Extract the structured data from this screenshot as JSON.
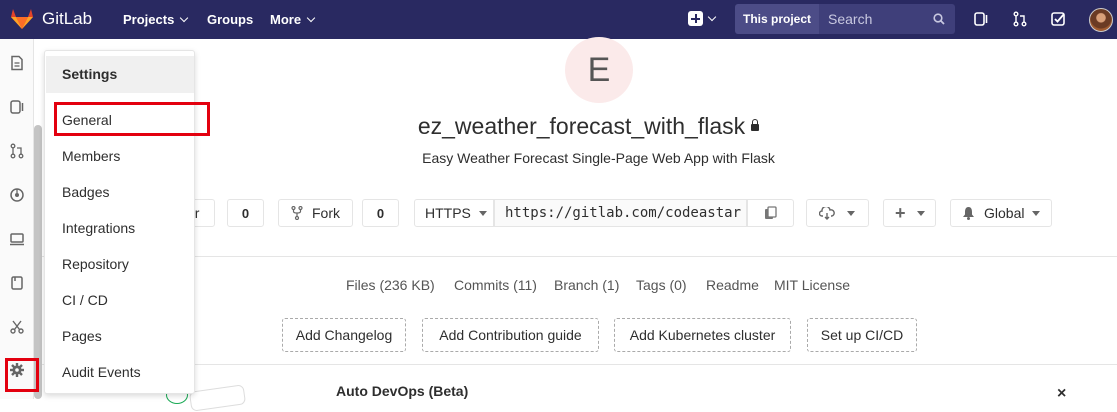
{
  "topbar": {
    "app_name": "GitLab",
    "nav": {
      "projects": "Projects",
      "groups": "Groups",
      "more": "More"
    },
    "scope_label": "This project",
    "search_placeholder": "Search",
    "icons": [
      "gitlab-logo",
      "plus-icon",
      "issues-icon",
      "merge-request-icon",
      "todo-check-icon",
      "search-icon",
      "user-avatar"
    ]
  },
  "sidebar": {
    "icons": [
      "project-icon",
      "issues-icon",
      "merge-request-icon",
      "ci-cd-icon",
      "operations-icon",
      "wiki-icon",
      "snippets-icon",
      "settings-gear-icon"
    ]
  },
  "settings_menu": {
    "header": "Settings",
    "items": [
      "General",
      "Members",
      "Badges",
      "Integrations",
      "Repository",
      "CI / CD",
      "Pages",
      "Audit Events"
    ]
  },
  "project": {
    "avatar_letter": "E",
    "name": "ez_weather_forecast_with_flask",
    "description": "Easy Weather Forecast Single-Page Web App with Flask",
    "star_label_fragment": "ar",
    "star_count": "0",
    "fork_label": "Fork",
    "fork_count": "0",
    "clone_protocol": "HTTPS",
    "clone_url": "https://gitlab.com/codeastar",
    "notification_label": "Global"
  },
  "stats": {
    "files": "Files (236 KB)",
    "commits": "Commits (11)",
    "branch": "Branch (1)",
    "tags": "Tags (0)",
    "readme": "Readme",
    "license": "MIT License"
  },
  "actions": {
    "add_changelog": "Add Changelog",
    "add_contribution": "Add Contribution guide",
    "add_kubernetes": "Add Kubernetes cluster",
    "setup_ci": "Set up CI/CD"
  },
  "banner": {
    "title": "Auto DevOps (Beta)",
    "close": "×"
  },
  "colors": {
    "topbar": "#292961",
    "highlight": "#e3000f",
    "avatar_bg": "#fbeaea"
  }
}
